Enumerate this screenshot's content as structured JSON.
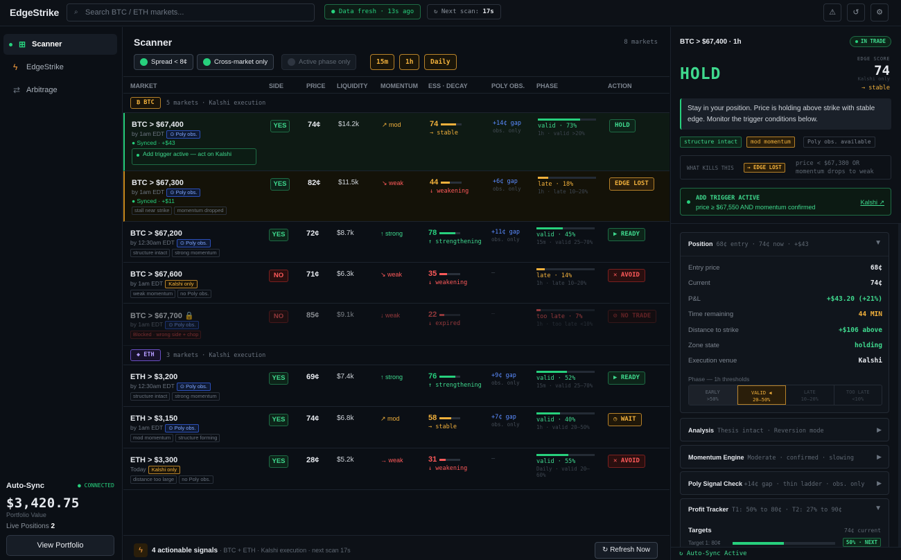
{
  "app": {
    "title": "EdgeStrike"
  },
  "topbar": {
    "search_placeholder": "Search BTC / ETH markets...",
    "data_fresh": "Data fresh · 13s ago",
    "next_scan_label": "Next scan:",
    "next_scan_value": "17s",
    "icons": [
      "alert-icon",
      "refresh-icon",
      "settings-icon"
    ]
  },
  "sidebar": {
    "items": [
      {
        "label": "Scanner",
        "icon": "grid-icon",
        "active": true
      },
      {
        "label": "EdgeStrike",
        "icon": "bolt-icon",
        "active": false
      },
      {
        "label": "Arbitrage",
        "icon": "arrows-icon",
        "active": false
      }
    ],
    "autosync": {
      "title": "Auto-Sync",
      "status": "● CONNECTED",
      "value": "$3,420.75",
      "value_label": "Portfolio Value",
      "live_label": "Live Positions",
      "live_count": "2",
      "button": "View Portfolio"
    }
  },
  "scanner": {
    "title": "Scanner",
    "market_count": "8 markets",
    "filters": [
      {
        "label": "Spread < 8¢",
        "on": true
      },
      {
        "label": "Cross-market only",
        "on": true
      },
      {
        "label": "Active phase only",
        "on": false
      }
    ],
    "timeframes": [
      "15m",
      "1h",
      "Daily"
    ],
    "columns": [
      "MARKET",
      "SIDE",
      "PRICE",
      "LIQUIDITY",
      "MOMENTUM",
      "ESS · DECAY",
      "POLY OBS.",
      "PHASE",
      "ACTION"
    ],
    "groups": [
      {
        "badge": "₿ BTC",
        "text": "5 markets · Kalshi execution"
      },
      {
        "badge": "◆ ETH",
        "text": "3 markets · Kalshi execution"
      }
    ],
    "rows": [
      {
        "name": "BTC > $67,400",
        "time": "by 1am EDT",
        "badge": "⊙ Poly obs.",
        "badge_type": "poly",
        "synced": "● Synced · +$43",
        "trigger": "Add trigger active — act on Kalshi",
        "tags": [],
        "side": "YES",
        "price": "74¢",
        "liquidity": "$14.2k",
        "momentum": "↗ mod",
        "mom_class": "o",
        "ess": "74",
        "ess_pct": 0.74,
        "ess_color": "#f2b13c",
        "ess_sub": "→ stable",
        "ess_sub_class": "o",
        "poly": "+14¢ gap",
        "poly_sub": "obs. only",
        "phase_pct": 0.73,
        "phase_color": "#27d07d",
        "phase": "valid · 73%",
        "phase_class": "g",
        "phase_sub": "1h · valid >20%",
        "action": "HOLD",
        "action_class": "hold",
        "style": "sel"
      },
      {
        "name": "BTC > $67,300",
        "time": "by 1am EDT",
        "badge": "⊙ Poly obs.",
        "badge_type": "poly",
        "synced": "● Synced · +$11",
        "trigger": "",
        "tags": [
          "stall near strike",
          "momentum dropped"
        ],
        "side": "YES",
        "price": "82¢",
        "liquidity": "$11.5k",
        "momentum": "↘ weak",
        "mom_class": "r",
        "ess": "44",
        "ess_pct": 0.44,
        "ess_color": "#f2b13c",
        "ess_sub": "↓ weakening",
        "ess_sub_class": "r",
        "poly": "+6¢ gap",
        "poly_sub": "obs. only",
        "phase_pct": 0.18,
        "phase_color": "#f2b13c",
        "phase": "late · 18%",
        "phase_class": "o",
        "phase_sub": "1h · late 10–20%",
        "action": "EDGE LOST",
        "action_class": "lost",
        "style": "warn"
      },
      {
        "name": "BTC > $67,200",
        "time": "by 12:30am EDT",
        "badge": "⊙ Poly obs.",
        "badge_type": "poly",
        "synced": "",
        "trigger": "",
        "tags": [
          "structure intact",
          "strong momentum"
        ],
        "side": "YES",
        "price": "72¢",
        "liquidity": "$8.7k",
        "momentum": "↑ strong",
        "mom_class": "g",
        "ess": "78",
        "ess_pct": 0.78,
        "ess_color": "#27d07d",
        "ess_sub": "↑ strengthening",
        "ess_sub_class": "g",
        "poly": "+11¢ gap",
        "poly_sub": "obs. only",
        "phase_pct": 0.45,
        "phase_color": "#27d07d",
        "phase": "valid · 45%",
        "phase_class": "g",
        "phase_sub": "15m · valid 25–70%",
        "action": "▶ READY",
        "action_class": "ready",
        "style": ""
      },
      {
        "name": "BTC > $67,600",
        "time": "by 1am EDT",
        "badge": "Kalshi only",
        "badge_type": "kalshi",
        "synced": "",
        "trigger": "",
        "tags": [
          "weak momentum",
          "no Poly obs."
        ],
        "side": "NO",
        "price": "71¢",
        "liquidity": "$6.3k",
        "momentum": "↘ weak",
        "mom_class": "r",
        "ess": "35",
        "ess_pct": 0.35,
        "ess_color": "#ff5a5a",
        "ess_sub": "↓ weakening",
        "ess_sub_class": "r",
        "poly": "—",
        "poly_sub": "",
        "phase_pct": 0.14,
        "phase_color": "#f2b13c",
        "phase": "late · 14%",
        "phase_class": "o",
        "phase_sub": "1h · late 10–20%",
        "action": "✕ AVOID",
        "action_class": "avoid",
        "style": ""
      },
      {
        "name": "BTC > $67,700 🔒",
        "time": "by 1am EDT",
        "badge": "⊙ Poly obs.",
        "badge_type": "poly",
        "synced": "",
        "trigger": "",
        "tags": [
          "Blocked · wrong side + chop"
        ],
        "tag_red": true,
        "side": "NO",
        "price": "85¢",
        "liquidity": "$9.1k",
        "momentum": "↓ weak",
        "mom_class": "r",
        "ess": "22",
        "ess_pct": 0.22,
        "ess_color": "#ff5a5a",
        "ess_sub": "↓ expired",
        "ess_sub_class": "r",
        "poly": "—",
        "poly_sub": "",
        "phase_pct": 0.07,
        "phase_color": "#ff5a5a",
        "phase": "too late · 7%",
        "phase_class": "r",
        "phase_sub": "1h · too late <10%",
        "action": "⊘ NO TRADE",
        "action_class": "notrade",
        "style": "dim"
      },
      {
        "name": "ETH > $3,200",
        "time": "by 12:30am EDT",
        "badge": "⊙ Poly obs.",
        "badge_type": "poly",
        "synced": "",
        "trigger": "",
        "tags": [
          "structure intact",
          "strong momentum"
        ],
        "side": "YES",
        "price": "69¢",
        "liquidity": "$7.4k",
        "momentum": "↑ strong",
        "mom_class": "g",
        "ess": "76",
        "ess_pct": 0.76,
        "ess_color": "#27d07d",
        "ess_sub": "↑ strengthening",
        "ess_sub_class": "g",
        "poly": "+9¢ gap",
        "poly_sub": "obs. only",
        "phase_pct": 0.52,
        "phase_color": "#27d07d",
        "phase": "valid · 52%",
        "phase_class": "g",
        "phase_sub": "15m · valid 25–70%",
        "action": "▶ READY",
        "action_class": "ready",
        "style": ""
      },
      {
        "name": "ETH > $3,150",
        "time": "by 1am EDT",
        "badge": "⊙ Poly obs.",
        "badge_type": "poly",
        "synced": "",
        "trigger": "",
        "tags": [
          "mod momentum",
          "structure forming"
        ],
        "side": "YES",
        "price": "74¢",
        "liquidity": "$6.8k",
        "momentum": "↗ mod",
        "mom_class": "o",
        "ess": "58",
        "ess_pct": 0.58,
        "ess_color": "#f2b13c",
        "ess_sub": "→ stable",
        "ess_sub_class": "o",
        "poly": "+7¢ gap",
        "poly_sub": "obs. only",
        "phase_pct": 0.4,
        "phase_color": "#27d07d",
        "phase": "valid · 40%",
        "phase_class": "g",
        "phase_sub": "1h · valid 20–50%",
        "action": "◷ WAIT",
        "action_class": "wait",
        "style": ""
      },
      {
        "name": "ETH > $3,300",
        "time": "Today",
        "badge": "Kalshi only",
        "badge_type": "kalshi",
        "synced": "",
        "trigger": "",
        "tags": [
          "distance too large",
          "no Poly obs."
        ],
        "side": "YES",
        "price": "28¢",
        "liquidity": "$5.2k",
        "momentum": "→ weak",
        "mom_class": "r",
        "ess": "31",
        "ess_pct": 0.31,
        "ess_color": "#ff5a5a",
        "ess_sub": "↓ weakening",
        "ess_sub_class": "r",
        "poly": "—",
        "poly_sub": "",
        "phase_pct": 0.55,
        "phase_color": "#27d07d",
        "phase": "valid · 55%",
        "phase_class": "g",
        "phase_sub": "Daily · valid 20–60%",
        "action": "✕ AVOID",
        "action_class": "avoid",
        "style": ""
      }
    ],
    "footer": {
      "title": "4 actionable signals",
      "sub": "· BTC + ETH · Kalshi execution · next scan 17s",
      "refresh": "↻ Refresh Now"
    }
  },
  "detail": {
    "title": "BTC > $67,400 · 1h",
    "badge": "IN TRADE",
    "verdict": "HOLD",
    "edge_label": "EDGE SCORE",
    "edge_score": "74",
    "edge_venue": "Kalshi only",
    "edge_trend": "→ stable",
    "message": "Stay in your position. Price is holding above strike with stable edge. Monitor the trigger conditions below.",
    "tags": [
      {
        "label": "structure intact",
        "kind": "g"
      },
      {
        "label": "mod momentum",
        "kind": "o"
      },
      {
        "label": "Poly obs. available",
        "kind": "n"
      }
    ],
    "what_kills_label": "WHAT KILLS THIS",
    "what_kills_badge": "→ EDGE LOST",
    "what_kills_text": "price < $67,380 OR momentum drops to weak",
    "add_trigger": {
      "title": "ADD TRIGGER ACTIVE",
      "sub": "price ≥ $67,550 AND momentum confirmed",
      "link": "Kalshi ↗"
    },
    "position": {
      "title": "Position",
      "summary": "68¢ entry · 74¢ now · +$43",
      "rows": [
        {
          "label": "Entry price",
          "value": "68¢",
          "cls": ""
        },
        {
          "label": "Current",
          "value": "74¢",
          "cls": ""
        },
        {
          "label": "P&L",
          "value": "+$43.20 (+21%)",
          "cls": "g"
        },
        {
          "label": "Time remaining",
          "value": "44 MIN",
          "cls": "o"
        },
        {
          "label": "Distance to strike",
          "value": "+$106 above",
          "cls": "g"
        },
        {
          "label": "Zone state",
          "value": "holding",
          "cls": "g"
        },
        {
          "label": "Execution venue",
          "value": "Kalshi",
          "cls": ""
        }
      ],
      "phase_label": "Phase — 1h thresholds",
      "phases": [
        {
          "name": "EARLY",
          "range": ">50%"
        },
        {
          "name": "VALID ◀",
          "range": "20–50%"
        },
        {
          "name": "LATE",
          "range": "10–20%"
        },
        {
          "name": "TOO LATE",
          "range": "<10%"
        }
      ]
    },
    "accordions": [
      {
        "title": "Analysis",
        "sub": "Thesis intact · Reversion mode"
      },
      {
        "title": "Momentum Engine",
        "sub": "Moderate · confirmed · slowing"
      },
      {
        "title": "Poly Signal Check",
        "sub": "+14¢ gap · thin ladder · obs. only"
      }
    ],
    "profit": {
      "title": "Profit Tracker",
      "sub": "T1: 50% to 80¢ · T2: 27% to 90¢",
      "targets_label": "Targets",
      "targets_current": "74¢ current",
      "t1_label": "Target 1: 80¢",
      "t1_pct": 0.5,
      "t1_badge": "50% · NEXT"
    },
    "autosync_active": "↻ Auto-Sync Active"
  }
}
